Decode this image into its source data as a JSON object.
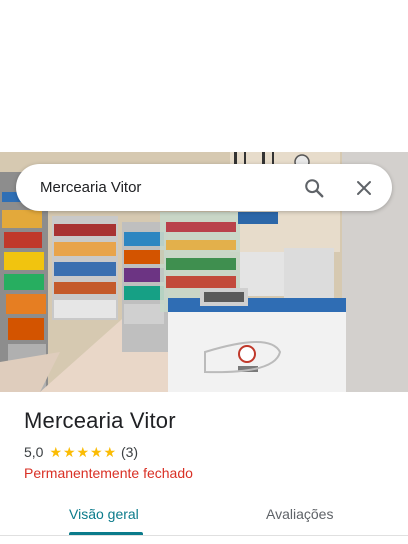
{
  "search": {
    "query": "Mercearia Vitor"
  },
  "icons": {
    "search": "search-icon",
    "close": "close-icon",
    "star": "star-icon"
  },
  "place": {
    "name": "Mercearia Vitor",
    "rating": "5,0",
    "rating_stars": 5,
    "review_count": "(3)",
    "status": "Permanentemente fechado"
  },
  "tabs": [
    {
      "label": "Visão geral",
      "active": true
    },
    {
      "label": "Avaliações",
      "active": false
    }
  ],
  "colors": {
    "accent": "#0b7b8b",
    "status_closed": "#d93025",
    "star": "#fbbc04"
  }
}
